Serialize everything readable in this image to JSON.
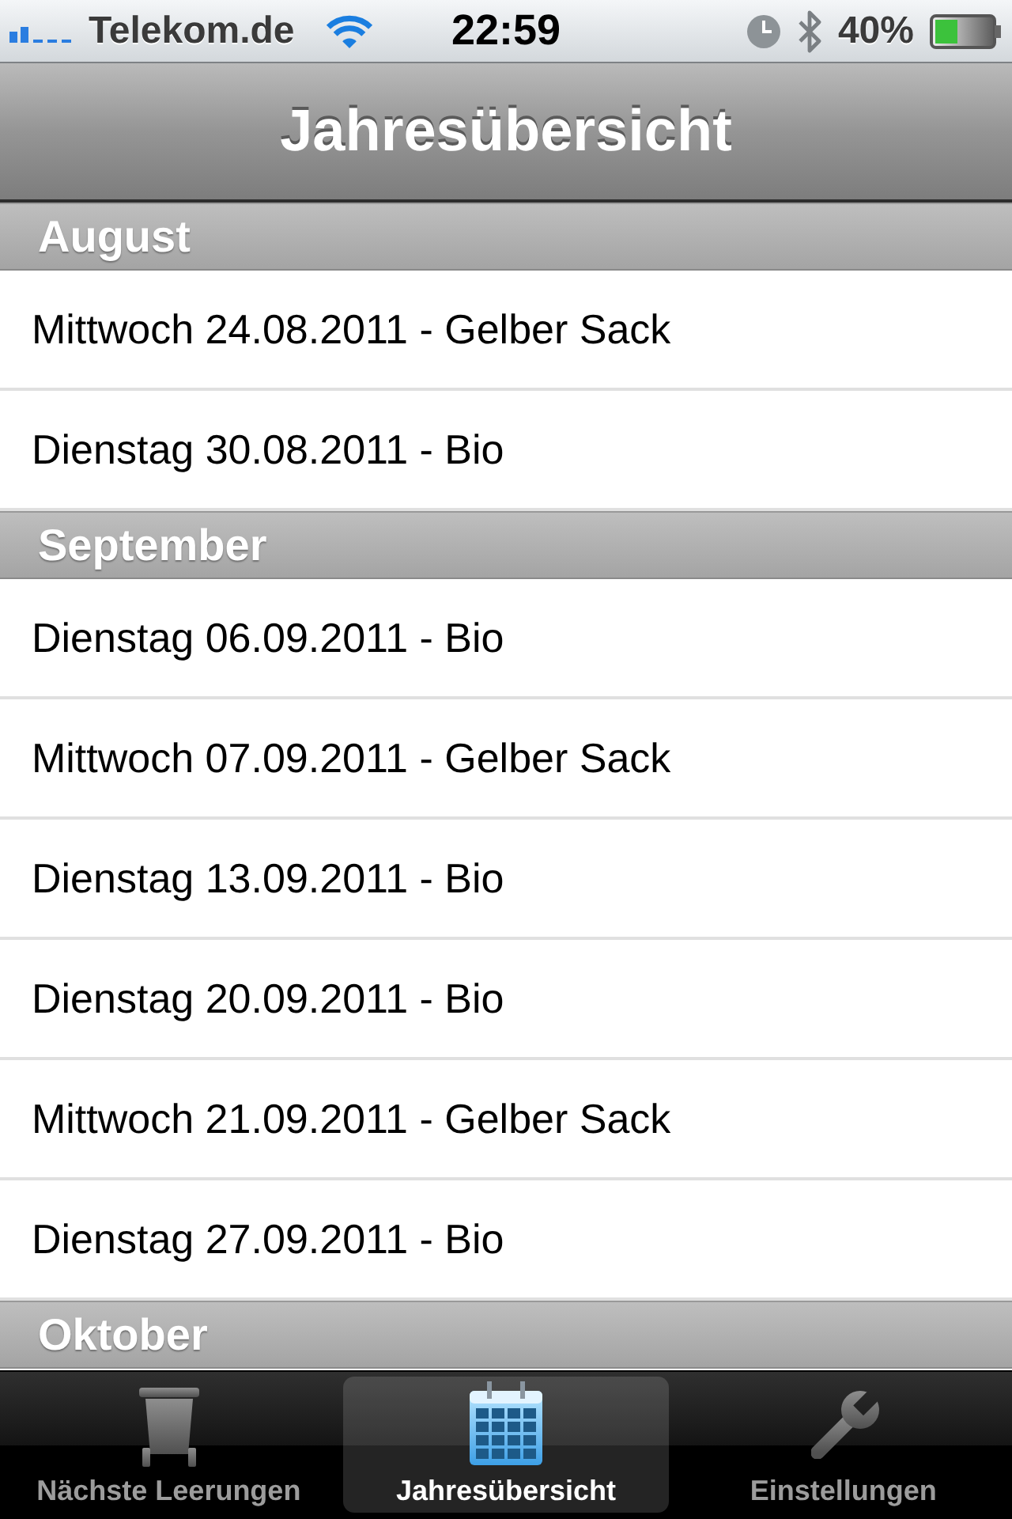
{
  "status_bar": {
    "carrier": "Telekom.de",
    "time": "22:59",
    "battery": "40%"
  },
  "navigation_bar": {
    "title": "Jahresübersicht"
  },
  "sections": [
    {
      "title": "August",
      "rows": [
        "Mittwoch 24.08.2011 - Gelber Sack",
        "Dienstag 30.08.2011 - Bio"
      ]
    },
    {
      "title": "September",
      "rows": [
        "Dienstag 06.09.2011 - Bio",
        "Mittwoch 07.09.2011 - Gelber Sack",
        "Dienstag 13.09.2011 - Bio",
        "Dienstag 20.09.2011 - Bio",
        "Mittwoch 21.09.2011 - Gelber Sack",
        "Dienstag 27.09.2011 - Bio"
      ]
    },
    {
      "title": "Oktober"
    }
  ],
  "tab_bar": {
    "tabs": [
      {
        "label": "Nächste Leerungen",
        "kind": "bin",
        "selected": false
      },
      {
        "label": "Jahresübersicht",
        "kind": "calendar",
        "selected": true
      },
      {
        "label": "Einstellungen",
        "kind": "wrench",
        "selected": false
      }
    ]
  }
}
